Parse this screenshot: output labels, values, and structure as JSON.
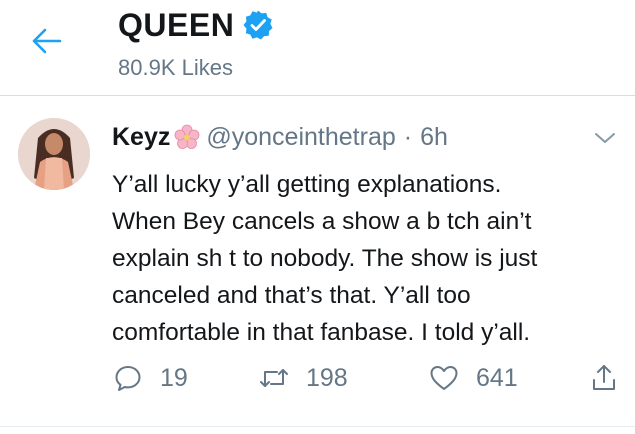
{
  "header": {
    "title": "QUEEN",
    "subtitle": "80.9K Likes",
    "accent_color": "#1da1f2",
    "back_icon": "arrow-left-icon",
    "verified_icon": "verified-badge-icon"
  },
  "tweet": {
    "name": "Keyz",
    "name_emoji": "cherry-blossom-icon",
    "handle": "@yonceinthetrap",
    "separator": "·",
    "time": "6h",
    "lines": [
      "Y’all lucky y’all getting explanations.",
      "When Bey cancels a show a b tch ain’t",
      "explain sh t to nobody. The show is just",
      "canceled and that’s that. Y’all too",
      "comfortable in that fanbase. I told y’all."
    ],
    "actions": {
      "replies": "19",
      "retweets": "198",
      "likes": "641"
    }
  }
}
